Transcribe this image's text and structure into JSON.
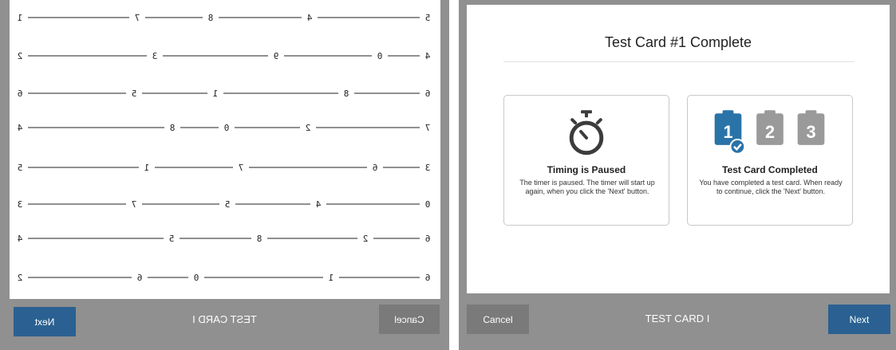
{
  "left": {
    "rows": [
      [
        "1",
        "7",
        "8",
        "4",
        "5"
      ],
      [
        "2",
        "3",
        "9",
        "0",
        "4"
      ],
      [
        "6",
        "5",
        "1",
        "8",
        "6"
      ],
      [
        "4",
        "8",
        "0",
        "2",
        "7"
      ],
      [
        "5",
        "1",
        "7",
        "6",
        "3"
      ],
      [
        "3",
        "7",
        "5",
        "4",
        "0"
      ],
      [
        "4",
        "5",
        "8",
        "2",
        "6"
      ],
      [
        "2",
        "6",
        "0",
        "1",
        "6"
      ]
    ],
    "footer": {
      "title": "TEST CARD I",
      "cancel": "Cancel",
      "next": "Next"
    }
  },
  "right": {
    "title": "Test Card #1 Complete",
    "timer_box": {
      "icon": "stopwatch-icon",
      "title": "Timing is Paused",
      "text": "The timer is paused. The timer will start up again, when you click the 'Next' button."
    },
    "complete_box": {
      "icons": [
        "1",
        "2",
        "3"
      ],
      "title": "Test Card Completed",
      "text": "You have completed a test card. When ready to continue, click the 'Next' button."
    },
    "footer": {
      "title": "TEST CARD I",
      "cancel": "Cancel",
      "next": "Next"
    }
  },
  "colors": {
    "accent": "#2a6192",
    "gray": "#909090",
    "cancel": "#7a7a7a",
    "badge": "#2a73a8",
    "badge_inactive": "#9a9a9a"
  }
}
